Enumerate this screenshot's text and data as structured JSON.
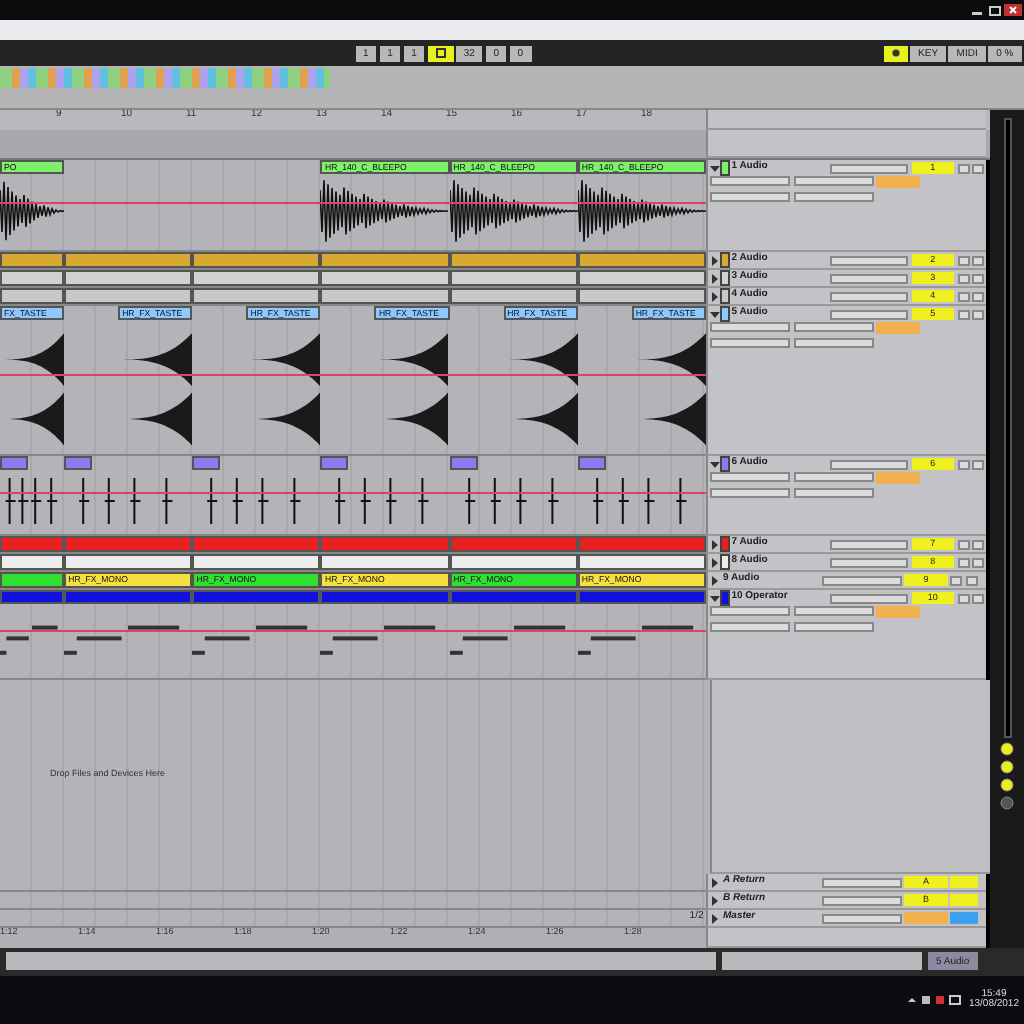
{
  "toolbar": {
    "toggles": [
      {
        "on": true
      },
      {
        "on": true
      }
    ],
    "buttons": [
      {
        "label": "1"
      },
      {
        "label": "1"
      },
      {
        "label": "1"
      },
      {
        "label": "32"
      },
      {
        "label": "0"
      },
      {
        "label": "0"
      }
    ],
    "right_buttons": [
      {
        "label": "KEY"
      },
      {
        "label": "MIDI"
      },
      {
        "label": "0 %"
      }
    ]
  },
  "ruler": {
    "bars": [
      "9",
      "10",
      "11",
      "12",
      "13",
      "14",
      "15",
      "16",
      "17",
      "18"
    ]
  },
  "tracks": [
    {
      "name": "1 Audio",
      "number": "1",
      "kind": "wave",
      "expanded": true,
      "color": "#7ff06a",
      "clips": [
        {
          "kind": "clip",
          "label": "PO"
        },
        {
          "kind": "gap"
        },
        {
          "kind": "gap"
        },
        {
          "kind": "clip",
          "label": "HR_140_C_BLEEPO"
        },
        {
          "kind": "clip",
          "label": "HR_140_C_BLEEPO"
        },
        {
          "kind": "clip",
          "label": "HR_140_C_BLEEPO"
        }
      ]
    },
    {
      "name": "2 Audio",
      "number": "2",
      "kind": "strip",
      "expanded": false,
      "color": "#d8a830",
      "clips": [
        {
          "kind": "clip"
        },
        {
          "kind": "clip"
        },
        {
          "kind": "clip"
        },
        {
          "kind": "clip"
        },
        {
          "kind": "clip"
        },
        {
          "kind": "clip"
        }
      ]
    },
    {
      "name": "3 Audio",
      "number": "3",
      "kind": "strip",
      "expanded": false,
      "color": "#d0d0d0",
      "clips": [
        {
          "kind": "clip"
        },
        {
          "kind": "clip"
        },
        {
          "kind": "clip"
        },
        {
          "kind": "clip"
        },
        {
          "kind": "clip"
        },
        {
          "kind": "clip"
        }
      ]
    },
    {
      "name": "4 Audio",
      "number": "4",
      "kind": "strip",
      "expanded": false,
      "color": "#c8c8c8",
      "clips": [
        {
          "kind": "clip"
        },
        {
          "kind": "clip"
        },
        {
          "kind": "clip"
        },
        {
          "kind": "clip"
        },
        {
          "kind": "clip"
        },
        {
          "kind": "clip"
        }
      ]
    },
    {
      "name": "5 Audio",
      "number": "5",
      "kind": "tail-wave",
      "expanded": true,
      "color": "#8ec8ff",
      "clips": [
        {
          "kind": "clip",
          "label": "FX_TASTE"
        },
        {
          "kind": "clip",
          "label": "HR_FX_TASTE"
        },
        {
          "kind": "clip",
          "label": "HR_FX_TASTE"
        },
        {
          "kind": "clip",
          "label": "HR_FX_TASTE"
        },
        {
          "kind": "clip",
          "label": "HR_FX_TASTE"
        },
        {
          "kind": "clip",
          "label": "HR_FX_TASTE"
        }
      ]
    },
    {
      "name": "6 Audio",
      "number": "6",
      "kind": "hits",
      "expanded": true,
      "color": "#8a7cf0",
      "clips": [
        {
          "kind": "clip"
        },
        {
          "kind": "clip"
        },
        {
          "kind": "clip"
        },
        {
          "kind": "clip"
        },
        {
          "kind": "clip"
        },
        {
          "kind": "clip"
        }
      ]
    },
    {
      "name": "7 Audio",
      "number": "7",
      "kind": "strip",
      "expanded": false,
      "color": "#e82020",
      "clips": [
        {
          "kind": "clip"
        },
        {
          "kind": "clip"
        },
        {
          "kind": "clip"
        },
        {
          "kind": "clip"
        },
        {
          "kind": "clip"
        },
        {
          "kind": "clip"
        }
      ]
    },
    {
      "name": "8 Audio",
      "number": "8",
      "kind": "strip",
      "expanded": false,
      "color": "#ececec",
      "clips": [
        {
          "kind": "clip"
        },
        {
          "kind": "clip"
        },
        {
          "kind": "clip"
        },
        {
          "kind": "clip"
        },
        {
          "kind": "clip"
        },
        {
          "kind": "clip"
        }
      ]
    },
    {
      "name": "9 Audio",
      "number": "9",
      "kind": "strip",
      "expanded": false,
      "clips": [
        {
          "kind": "clip",
          "color": "#30e030"
        },
        {
          "kind": "clip",
          "label": "HR_FX_MONO",
          "color": "#f5e040"
        },
        {
          "kind": "clip",
          "label": "HR_FX_MONO",
          "color": "#30e030"
        },
        {
          "kind": "clip",
          "label": "HR_FX_MONO",
          "color": "#f5e040"
        },
        {
          "kind": "clip",
          "label": "HR_FX_MONO",
          "color": "#30e030"
        },
        {
          "kind": "clip",
          "label": "HR_FX_MONO",
          "color": "#f5e040"
        }
      ]
    },
    {
      "name": "10 Operator",
      "number": "10",
      "kind": "midi",
      "expanded": true,
      "color": "#1010e0",
      "clips": [
        {
          "kind": "clip"
        },
        {
          "kind": "clip"
        },
        {
          "kind": "clip"
        },
        {
          "kind": "clip"
        },
        {
          "kind": "clip"
        },
        {
          "kind": "clip"
        }
      ]
    }
  ],
  "drop_hint": "Drop Files and Devices Here",
  "returns": [
    {
      "name": "A Return",
      "number": "A",
      "kind": "return"
    },
    {
      "name": "B Return",
      "number": "B",
      "kind": "return"
    },
    {
      "name": "Master",
      "kind": "master",
      "page": "1/2"
    }
  ],
  "time_ruler": [
    "1:12",
    "1:14",
    "1:16",
    "1:18",
    "1:20",
    "1:22",
    "1:24",
    "1:26",
    "1:28"
  ],
  "status_bar": {
    "track_button": "5 Audio"
  },
  "taskbar": {
    "time": "15:49",
    "date": "13/08/2012"
  }
}
